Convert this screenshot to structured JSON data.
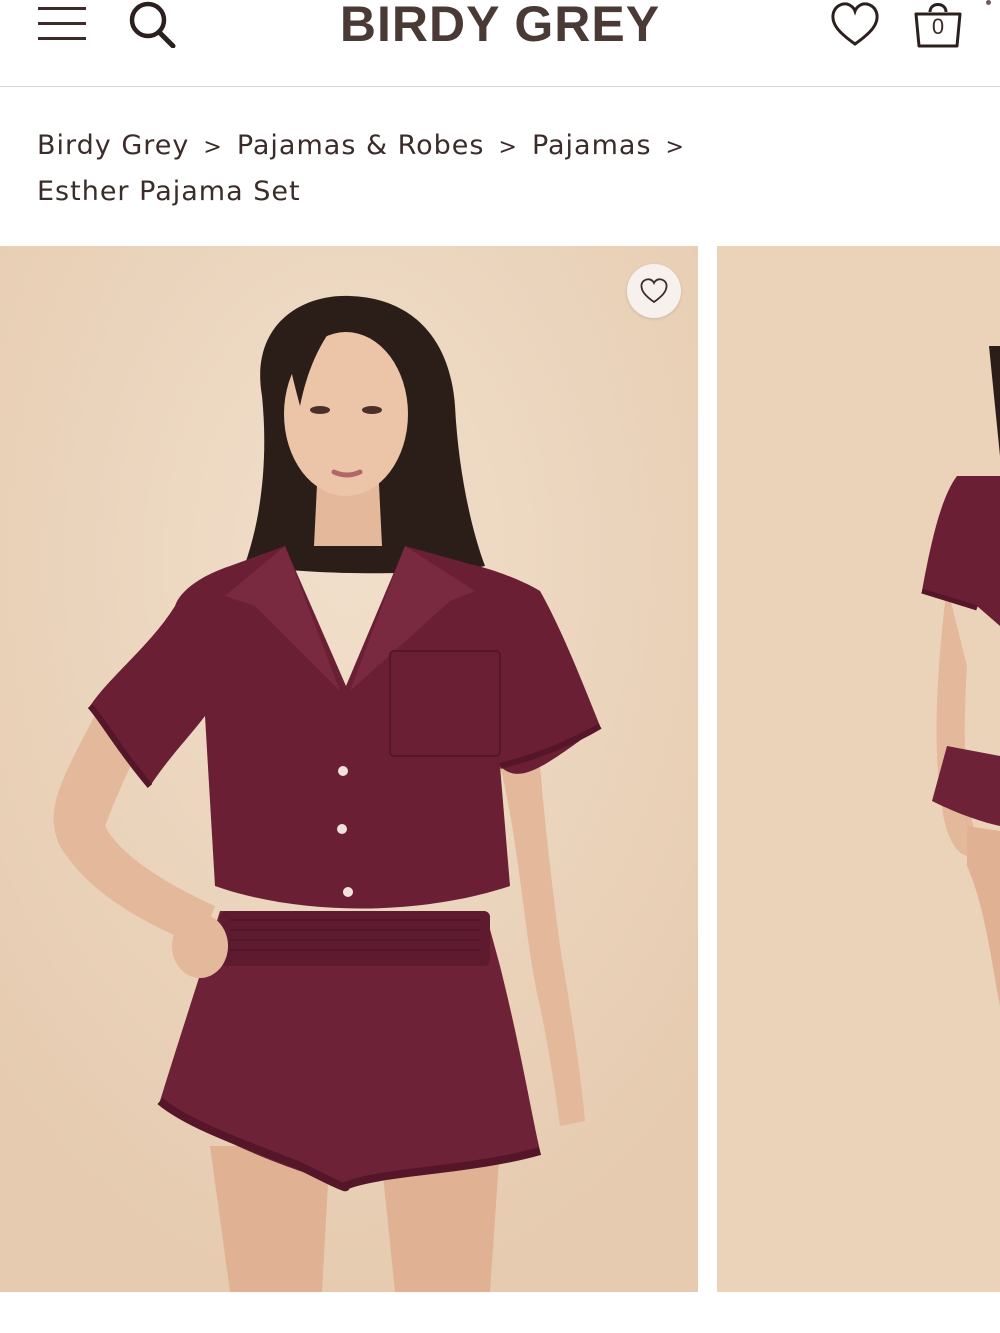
{
  "header": {
    "brand": "BIRDY GREY",
    "cart_count": "0",
    "icons": [
      "menu-icon",
      "search-icon",
      "heart-icon",
      "shopping-bag-icon"
    ]
  },
  "breadcrumb": {
    "items": [
      "Birdy Grey",
      "Pajamas & Robes",
      "Pajamas",
      "Esther Pajama Set"
    ],
    "separator": ">"
  },
  "gallery": {
    "favorite_icon": "heart-icon",
    "colors": {
      "background": "#ecd6bf",
      "garment": "#6b1f34",
      "brand_text": "#4a3a36"
    }
  }
}
